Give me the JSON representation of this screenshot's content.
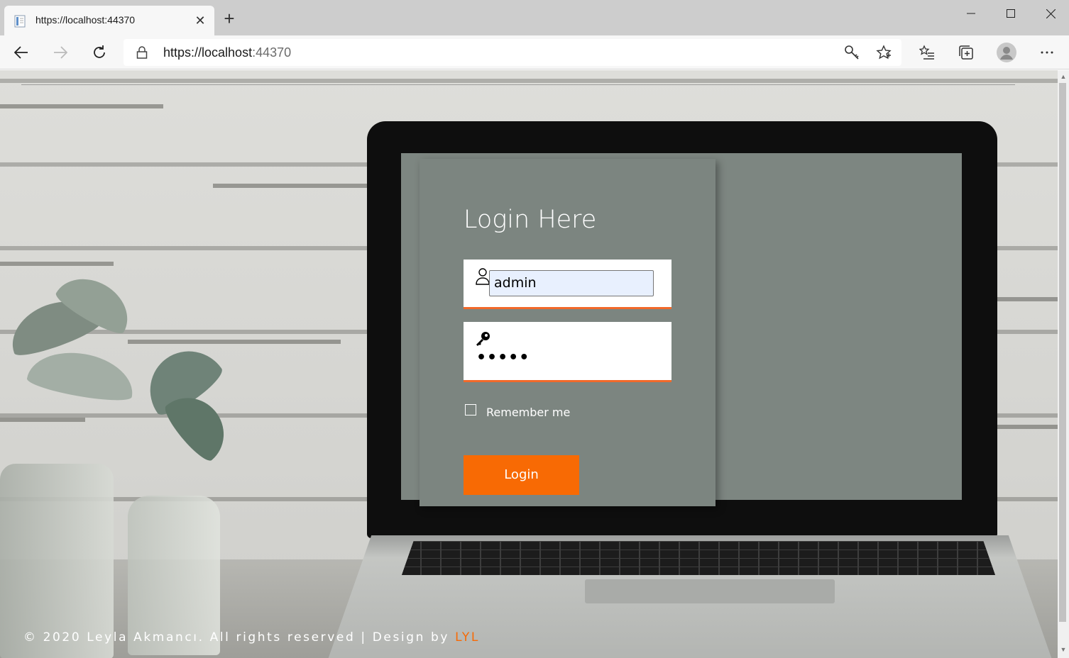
{
  "browser": {
    "tab": {
      "title": "https://localhost:44370",
      "close_glyph": "✕"
    },
    "new_tab_glyph": "+",
    "address": {
      "scheme_host": "https://localhost",
      "port": ":44370"
    },
    "icons": {
      "favicon": "page-icon",
      "back": "arrow-left-icon",
      "forward": "arrow-right-icon",
      "refresh": "refresh-icon",
      "lock": "lock-icon",
      "key": "key-icon",
      "favorite": "star-icon",
      "favorites_list": "favorites-icon",
      "collections": "collections-icon",
      "profile": "avatar-icon",
      "menu": "more-icon"
    }
  },
  "page": {
    "login": {
      "title": "Login Here",
      "username_value": "admin",
      "password_mask": "•••••",
      "remember_label": "Remember me",
      "remember_checked": false,
      "submit_label": "Login"
    },
    "footer": {
      "text": "© 2020 Leyla Akmancı. All rights reserved | Design by ",
      "brand": "LYL"
    }
  },
  "colors": {
    "accent": "#f86a04",
    "card": "#7c8580",
    "field_underline": "#f2692a"
  }
}
